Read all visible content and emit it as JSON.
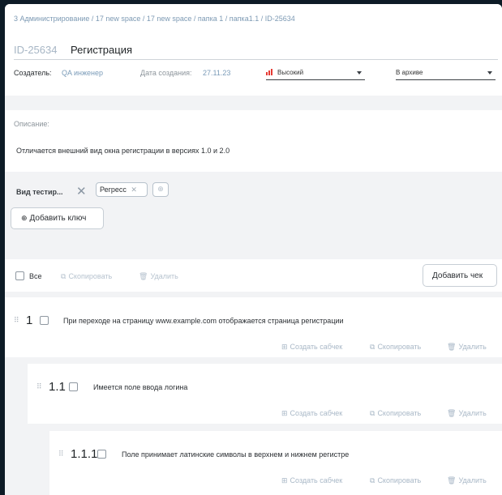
{
  "breadcrumb": "3 Администрирование / 17 new space / 17 new space / папка 1 / папка1.1 / ID-25634",
  "header": {
    "id": "ID-25634",
    "title": "Регистрация",
    "creator_label": "Создатель:",
    "creator_value": "QA инженер",
    "created_label": "Дата создания:",
    "created_value": "27.11.23",
    "priority": "Высокий",
    "status": "В архиве"
  },
  "description": {
    "label": "Описание:",
    "text": "Отличается внешний вид окна регистрации в версиях 1.0 и 2.0"
  },
  "keys": {
    "label": "Вид тестир...",
    "chip": "Регресс",
    "add_key": "Добавить ключ"
  },
  "toolbar": {
    "all": "Все",
    "copy": "Скопировать",
    "delete": "Удалить",
    "add_check": "Добавить чек"
  },
  "actions": {
    "create_subcheck": "Создать сабчек",
    "copy": "Скопировать",
    "delete": "Удалить"
  },
  "checks": [
    {
      "number": "1",
      "text": "При переходе на страницу www.example.com отображается страница регистрации"
    },
    {
      "number": "1.1",
      "text": "Имеется поле ввода логина"
    },
    {
      "number": "1.1.1",
      "text": "Поле принимает латинские символы в верхнем и нижнем регистре"
    }
  ],
  "colors": {
    "priority": "#e53b34",
    "link": "#7a9bb8",
    "background": "#0d1b26"
  }
}
